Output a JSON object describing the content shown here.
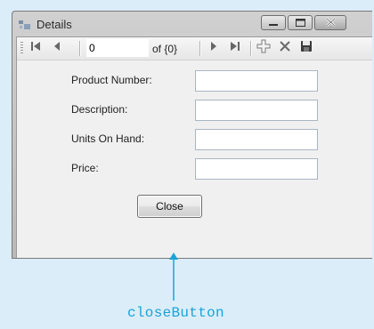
{
  "window": {
    "title": "Details",
    "controls": {
      "minimize_icon": "minimize-icon",
      "maximize_icon": "maximize-icon",
      "close_icon": "close-x-icon"
    }
  },
  "navigator": {
    "position_value": "0",
    "count_text": "of {0}",
    "buttons": [
      "move-first-icon",
      "move-previous-icon",
      "move-next-icon",
      "move-last-icon",
      "add-new-icon",
      "delete-icon",
      "save-icon"
    ]
  },
  "fields": [
    {
      "label": "Product Number:",
      "value": ""
    },
    {
      "label": "Description:",
      "value": ""
    },
    {
      "label": "Units On Hand:",
      "value": ""
    },
    {
      "label": "Price:",
      "value": ""
    }
  ],
  "close_button": {
    "label": "Close"
  },
  "annotation": {
    "text": "closeButton",
    "color": "#1aa3d8"
  }
}
